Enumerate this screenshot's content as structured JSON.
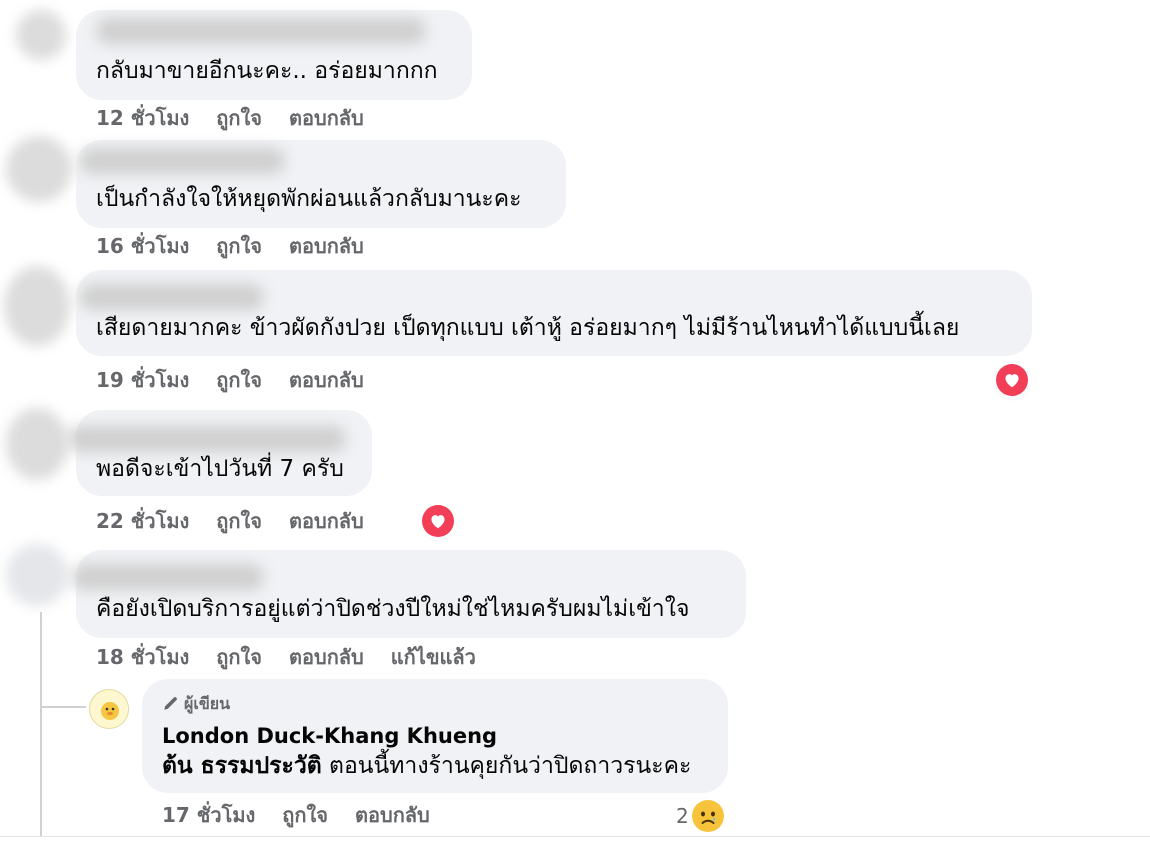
{
  "comments": [
    {
      "text": "กลับมาขายอีกนะคะ.. อร่อยมากกก",
      "time": "12 ชั่วโมง",
      "like": "ถูกใจ",
      "reply": "ตอบกลับ"
    },
    {
      "text": "เป็นกำลังใจให้หยุดพักผ่อนแล้วกลับมานะคะ",
      "time": "16 ชั่วโมง",
      "like": "ถูกใจ",
      "reply": "ตอบกลับ"
    },
    {
      "text": "เสียดายมากคะ ข้าวผัดกังปวย เป็ดทุกแบบ เต้าหู้ อร่อยมากๆ ไม่มีร้านไหนทำได้แบบนี้เลย",
      "time": "19 ชั่วโมง",
      "like": "ถูกใจ",
      "reply": "ตอบกลับ",
      "reaction": "love-reaction-icon"
    },
    {
      "text": "พอดีจะเข้าไปวันที่ 7 ครับ",
      "time": "22 ชั่วโมง",
      "like": "ถูกใจ",
      "reply": "ตอบกลับ",
      "reaction": "love-reaction-icon"
    },
    {
      "text": "คือยังเปิดบริการอยู่แต่ว่าปิดช่วงปีใหม่ใช่ไหมครับผมไม่เข้าใจ",
      "time": "18 ชั่วโมง",
      "like": "ถูกใจ",
      "reply": "ตอบกลับ",
      "edited": "แก้ไขแล้ว"
    }
  ],
  "reply": {
    "badge": "ผู้เขียน",
    "badge_icon": "pen-icon",
    "author": "London Duck-Khang Khueng",
    "tagged": "ต้น ธรรมประวัติ",
    "text": "ตอนนี้ทางร้านคุยกันว่าปิดถาวรนะคะ",
    "time": "17 ชั่วโมง",
    "like": "ถูกใจ",
    "reply": "ตอบกลับ",
    "reaction_count": "2",
    "reaction": "sad-reaction-icon"
  },
  "colors": {
    "bubble": "#f0f2f5",
    "meta": "#65676b",
    "love": "#f33e58",
    "sad": "#f7c33a"
  }
}
